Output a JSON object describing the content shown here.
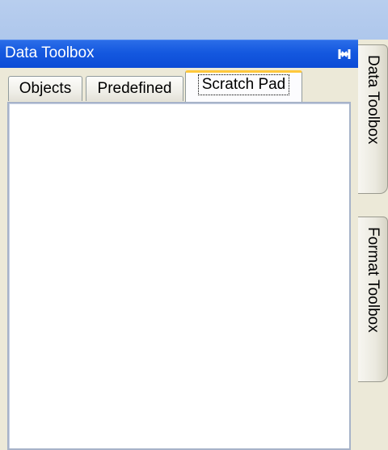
{
  "panel": {
    "title": "Data Toolbox",
    "pin_icon": "pin-icon",
    "tabs": [
      {
        "label": "Objects",
        "active": false
      },
      {
        "label": "Predefined",
        "active": false
      },
      {
        "label": "Scratch Pad",
        "active": true
      }
    ]
  },
  "side_tabs": [
    {
      "label": "Data Toolbox"
    },
    {
      "label": "Format Toolbox"
    }
  ],
  "colors": {
    "titlebar": "#0c4bd6",
    "active_tab_accent": "#ffc83c"
  }
}
